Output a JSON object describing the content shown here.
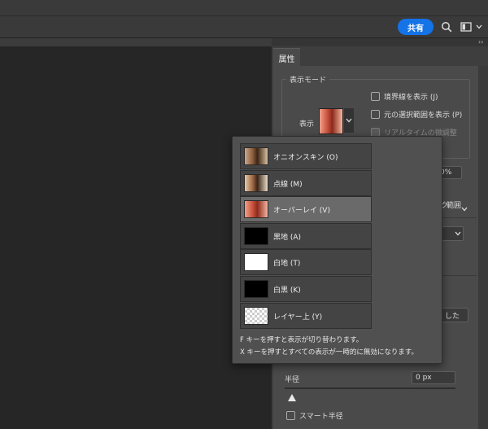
{
  "toolbar": {
    "share_label": "共有",
    "icons": [
      "search-icon",
      "panel-layout-icon",
      "chevron-down-icon"
    ]
  },
  "panel": {
    "tab_label": "属性",
    "collapse_glyph": "››",
    "display_mode": {
      "group_title": "表示モード",
      "view_label": "表示",
      "show_edges_label": "境界線を表示 (J)",
      "show_original_label": "元の選択範囲を表示 (P)",
      "realtime_label": "リアルタイムの微調整",
      "opacity_value": "0%",
      "partial_output_label": "範囲",
      "partial_output_prefix": "ク",
      "partial_button_label": "した"
    },
    "radius": {
      "label": "半径",
      "value": "0 px",
      "slider_fraction": 0.0
    },
    "smart_radius_label": "スマート半径"
  },
  "popup": {
    "options": [
      {
        "label": "オニオンスキン (O)",
        "thumb": "onion",
        "selected": false
      },
      {
        "label": "点線 (M)",
        "thumb": "dot",
        "selected": false
      },
      {
        "label": "オーバーレイ (V)",
        "thumb": "overlay",
        "selected": true
      },
      {
        "label": "黒地 (A)",
        "thumb": "black",
        "selected": false
      },
      {
        "label": "白地 (T)",
        "thumb": "white",
        "selected": false
      },
      {
        "label": "白黒 (K)",
        "thumb": "black",
        "selected": false
      },
      {
        "label": "レイヤー上 (Y)",
        "thumb": "trans",
        "selected": false
      }
    ],
    "hint1": "F キーを押すと表示が切り替わります。",
    "hint2": "X キーを押すとすべての表示が一時的に無効になります。"
  },
  "colors": {
    "accent": "#1473e6",
    "panel_bg": "#4a4a4a",
    "canvas_bg": "#262626"
  }
}
